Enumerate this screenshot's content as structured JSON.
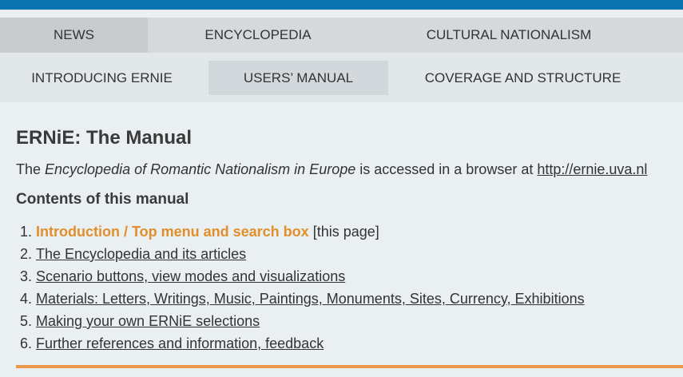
{
  "nav_primary": [
    {
      "label": "NEWS"
    },
    {
      "label": "ENCYCLOPEDIA"
    },
    {
      "label": "CULTURAL NATIONALISM"
    }
  ],
  "nav_secondary": [
    {
      "label": "INTRODUCING ERNIE"
    },
    {
      "label": "USERS’ MANUAL"
    },
    {
      "label": "COVERAGE AND STRUCTURE"
    }
  ],
  "page": {
    "title": "ERNiE: The Manual",
    "intro_prefix": "The ",
    "intro_em": "Encyclopedia of Romantic Nationalism in Europe",
    "intro_mid": " is accessed in a browser at ",
    "intro_link": "http://ernie.uva.nl",
    "contents_heading": "Contents of this manual",
    "toc": [
      {
        "label": "Introduction / Top menu and search box",
        "suffix": " [this page]"
      },
      {
        "label": "The Encyclopedia and its articles",
        "suffix": ""
      },
      {
        "label": "Scenario buttons, view modes and visualizations",
        "suffix": ""
      },
      {
        "label": "Materials: Letters, Writings, Music, Paintings, Monuments, Sites, Currency, Exhibitions",
        "suffix": ""
      },
      {
        "label": "Making your own ERNiE selections",
        "suffix": ""
      },
      {
        "label": "Further references and information, feedback",
        "suffix": ""
      }
    ]
  },
  "colors": {
    "top_bar": "#0a73b0",
    "active_link": "#e08f2a",
    "rule": "#e99a4c"
  }
}
